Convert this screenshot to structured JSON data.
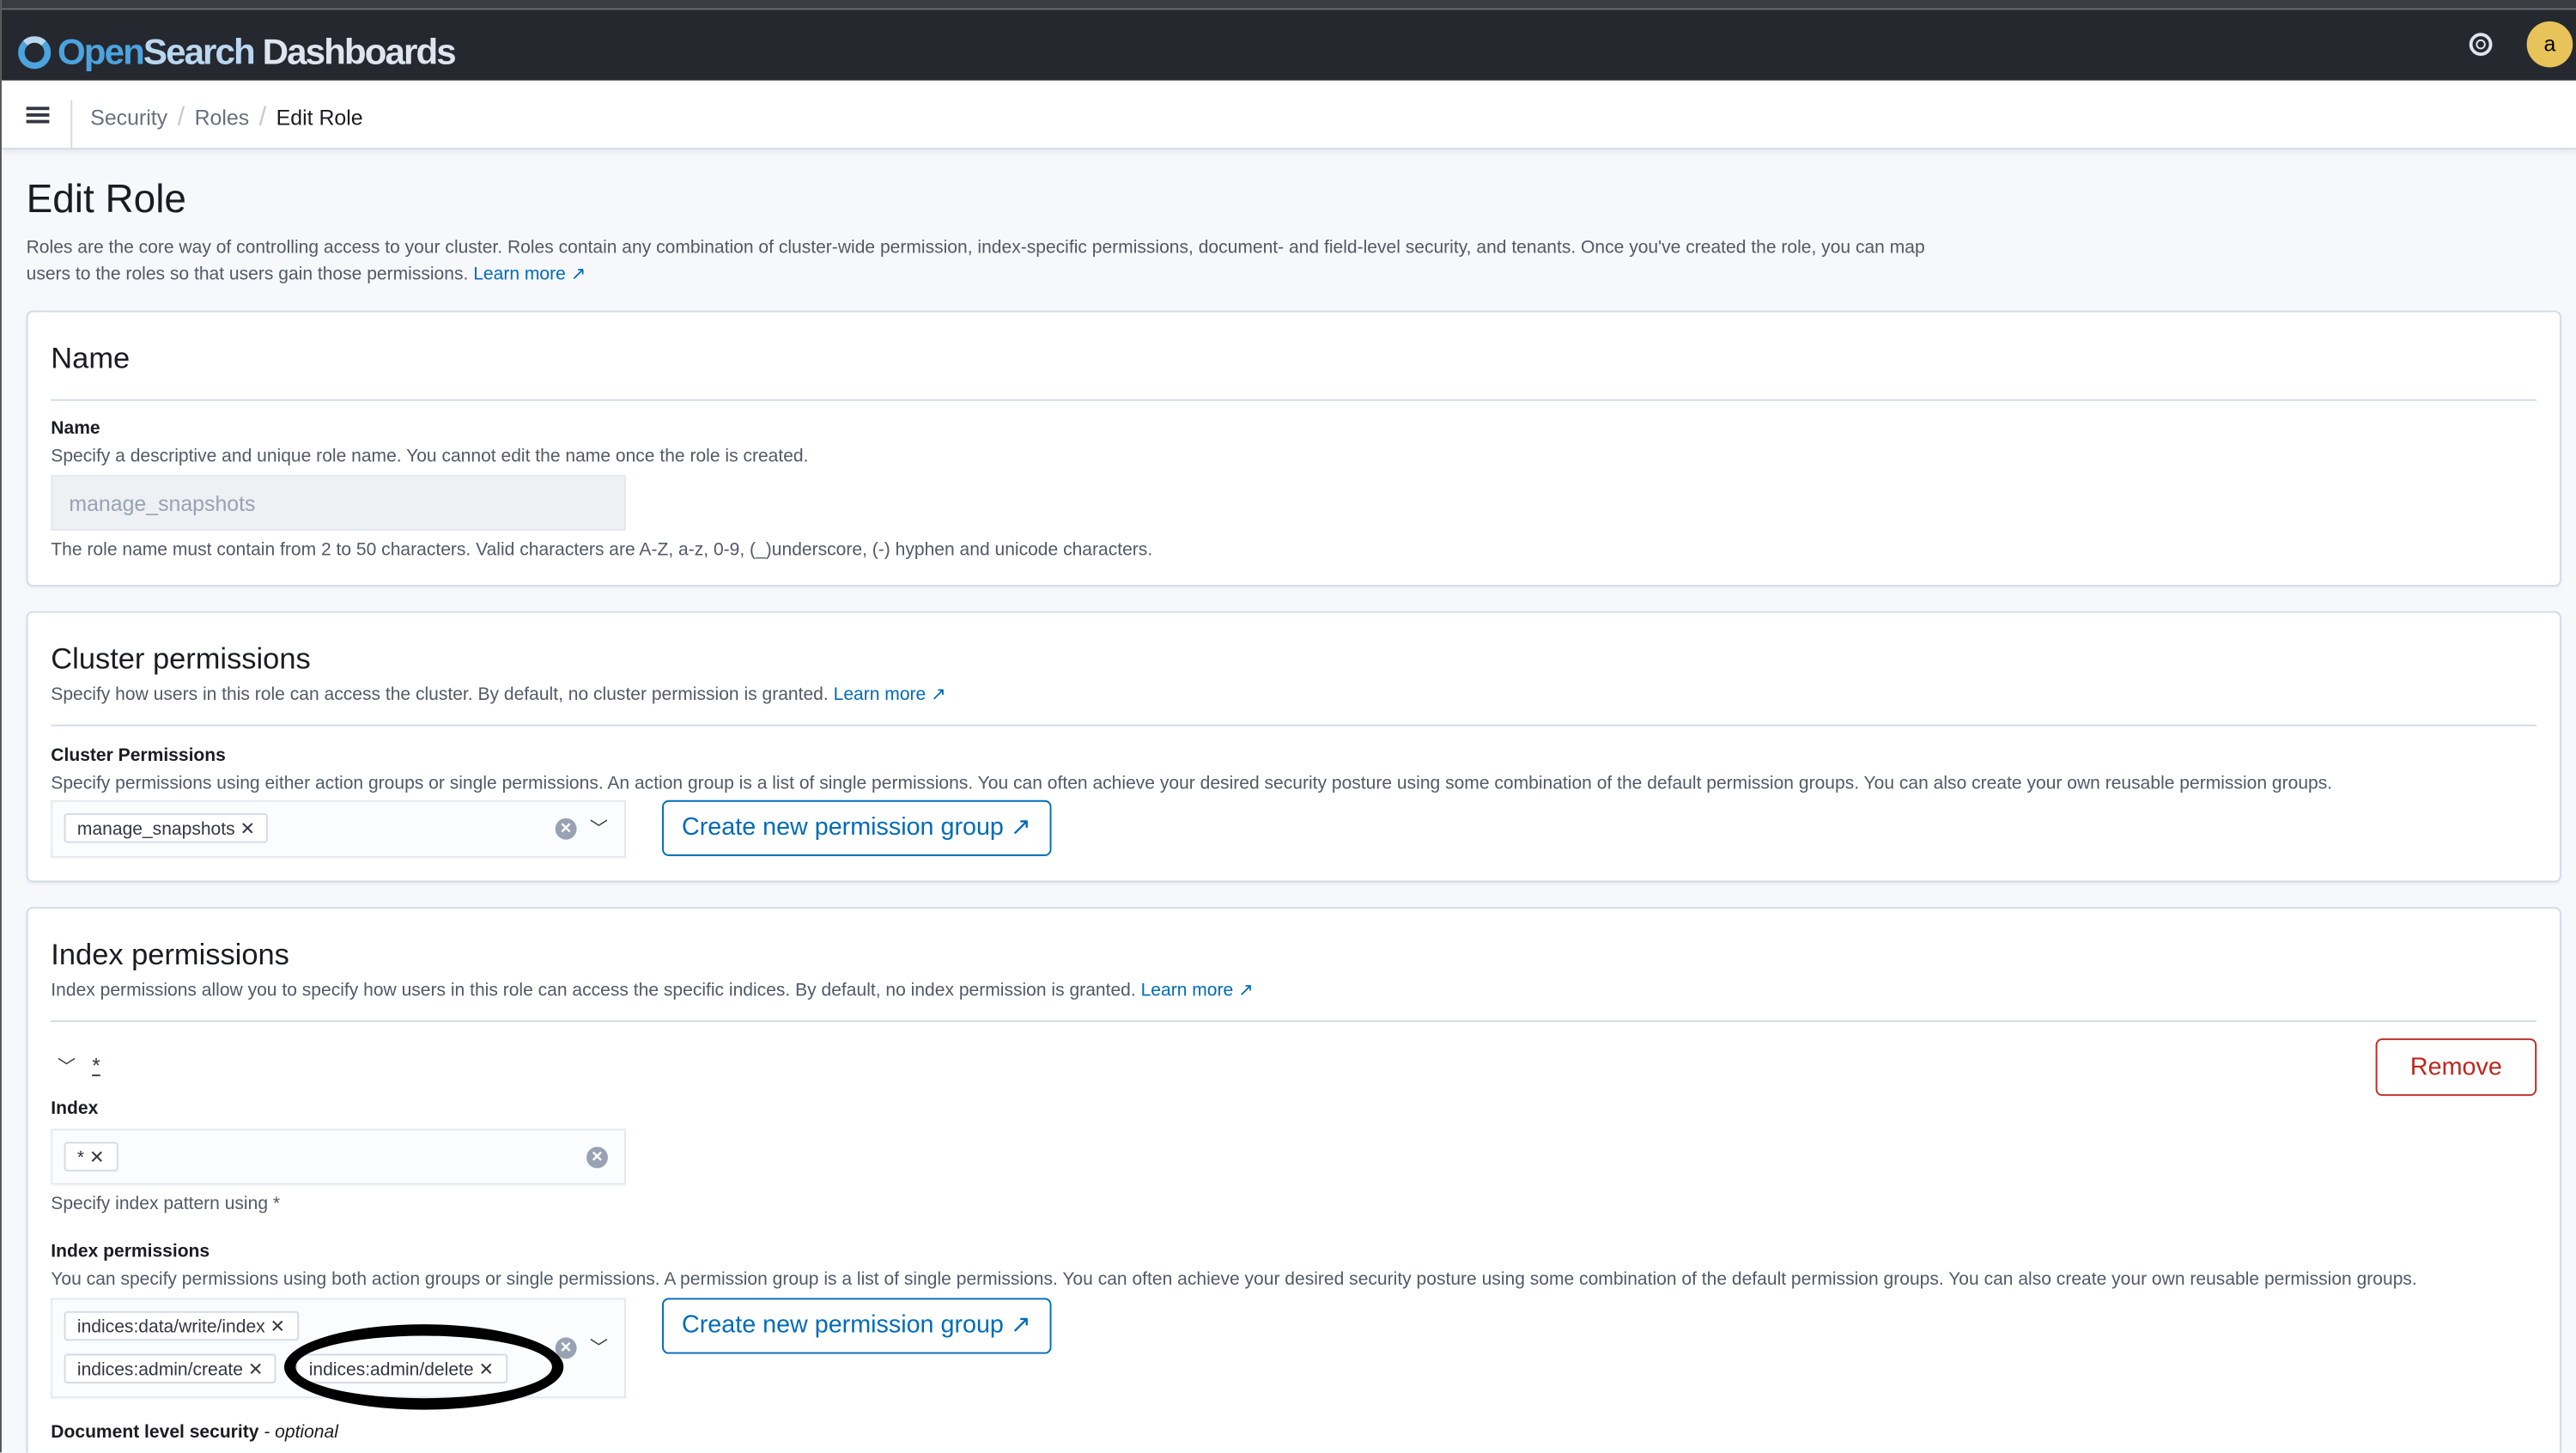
{
  "app": {
    "logo_part1": "Open",
    "logo_part2": "Search",
    "logo_part3": " Dashboards",
    "avatar_letter": "a",
    "accent": "#006bb8",
    "danger": "#bd271e"
  },
  "breadcrumbs": [
    "Security",
    "Roles",
    "Edit Role"
  ],
  "page": {
    "title": "Edit Role",
    "description": "Roles are the core way of controlling access to your cluster. Roles contain any combination of cluster-wide permission, index-specific permissions, document- and field-level security, and tenants. Once you've created the role, you can map users to the roles so that users gain those permissions.",
    "learn_more": "Learn more"
  },
  "name_panel": {
    "title": "Name",
    "label": "Name",
    "help": "Specify a descriptive and unique role name. You cannot edit the name once the role is created.",
    "value": "manage_snapshots",
    "hint": "The role name must contain from 2 to 50 characters. Valid characters are A-Z, a-z, 0-9, (_)underscore, (-) hyphen and unicode characters."
  },
  "cluster_panel": {
    "title": "Cluster permissions",
    "description": "Specify how users in this role can access the cluster. By default, no cluster permission is granted.",
    "learn_more": "Learn more",
    "label": "Cluster Permissions",
    "help": "Specify permissions using either action groups or single permissions. An action group is a list of single permissions. You can often achieve your desired security posture using some combination of the default permission groups. You can also create your own reusable permission groups.",
    "selected": [
      "manage_snapshots"
    ],
    "create_button": "Create new permission group"
  },
  "index_panel": {
    "title": "Index permissions",
    "description": "Index permissions allow you to specify how users in this role can access the specific indices. By default, no index permission is granted.",
    "learn_more": "Learn more",
    "entry_title": "*",
    "remove_button": "Remove",
    "index_label": "Index",
    "index_values": [
      "*"
    ],
    "index_help": "Specify index pattern using *",
    "perm_label": "Index permissions",
    "perm_help": "You can specify permissions using both action groups or single permissions. A permission group is a list of single permissions. You can often achieve your desired security posture using some combination of the default permission groups. You can also create your own reusable permission groups.",
    "perm_values": [
      "indices:data/write/index",
      "indices:admin/create",
      "indices:admin/delete"
    ],
    "create_button": "Create new permission group",
    "dls_label": "Document level security",
    "dls_optional": " - optional"
  }
}
